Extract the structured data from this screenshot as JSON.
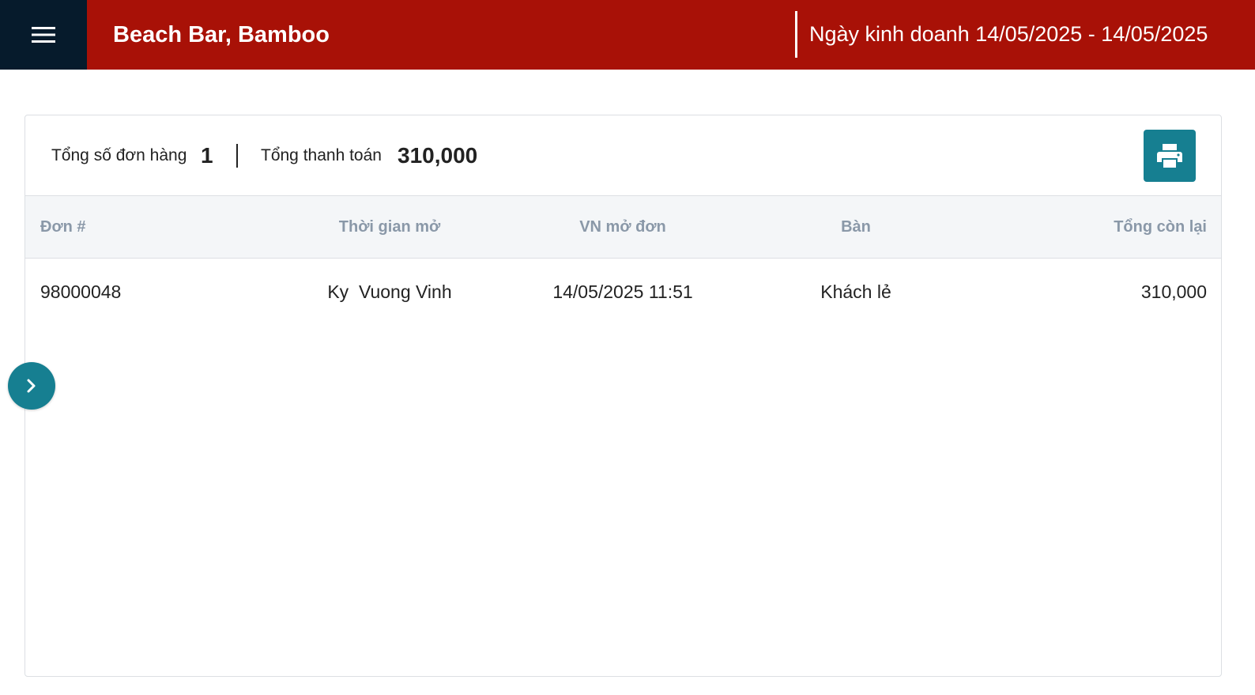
{
  "header": {
    "store_name": "Beach Bar, Bamboo",
    "business_date": "Ngày kinh doanh 14/05/2025 - 14/05/2025"
  },
  "summary": {
    "total_orders_label": "Tổng số đơn hàng",
    "total_orders_value": "1",
    "total_payment_label": "Tổng thanh toán",
    "total_payment_value": "310,000"
  },
  "table": {
    "columns": [
      "Đơn #",
      "Thời gian mở",
      "VN mở đơn",
      "Bàn",
      "Tổng còn lại"
    ],
    "rows": [
      [
        "98000048",
        "Ky  Vuong Vinh",
        "14/05/2025 11:51",
        "Khách lẻ",
        "310,000"
      ]
    ]
  },
  "colors": {
    "header_red": "#a81107",
    "menu_navy": "#061b2c",
    "accent_teal": "#167f91"
  },
  "icons": [
    "hamburger-menu-icon",
    "printer-icon",
    "chevron-right-icon"
  ]
}
